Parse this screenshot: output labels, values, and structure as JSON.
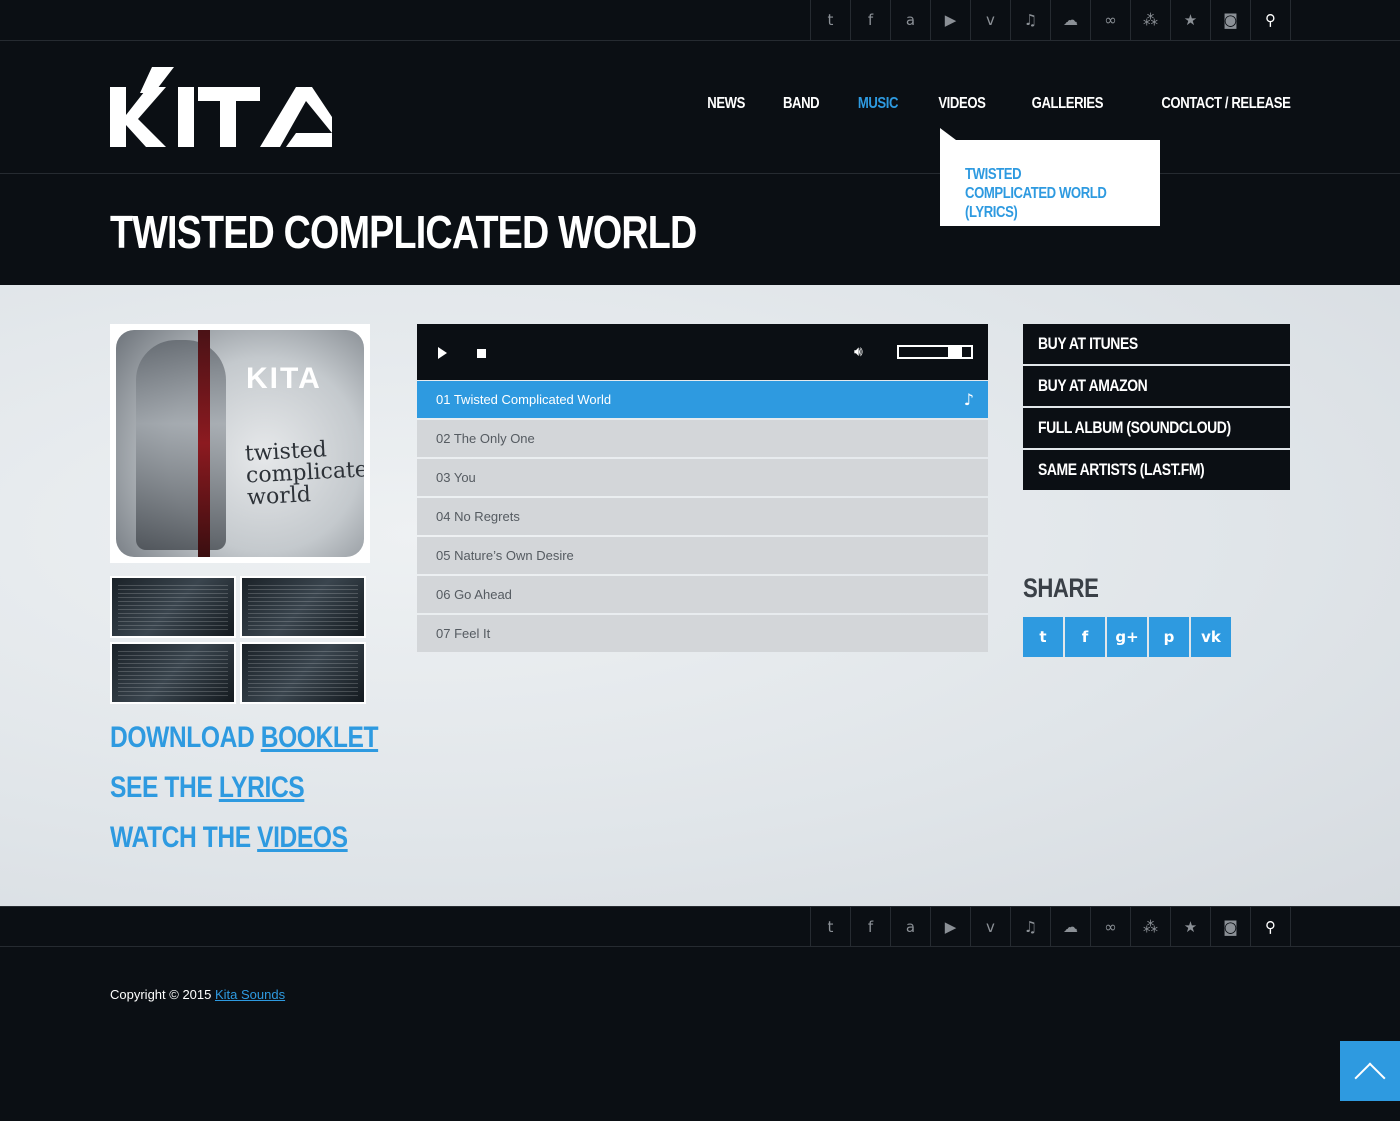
{
  "social_icons": [
    {
      "name": "twitter-icon",
      "glyph": "t"
    },
    {
      "name": "facebook-icon",
      "glyph": "f"
    },
    {
      "name": "amazon-icon",
      "glyph": "a"
    },
    {
      "name": "youtube-icon",
      "glyph": "▶"
    },
    {
      "name": "vimeo-icon",
      "glyph": "v"
    },
    {
      "name": "itunes-icon",
      "glyph": "♫"
    },
    {
      "name": "soundcloud-icon",
      "glyph": "☁"
    },
    {
      "name": "lastfm-icon",
      "glyph": "∞"
    },
    {
      "name": "myspace-icon",
      "glyph": "⁂"
    },
    {
      "name": "reverbnation-icon",
      "glyph": "★"
    },
    {
      "name": "instagram-icon",
      "glyph": "◙"
    },
    {
      "name": "search-icon",
      "glyph": "⚲"
    }
  ],
  "logo": {
    "text": "KITA"
  },
  "nav": {
    "items": [
      "NEWS",
      "BAND",
      "MUSIC",
      "VIDEOS",
      "GALLERIES",
      "CONTACT / RELEASE"
    ],
    "active": "MUSIC",
    "dropdown_item": "TWISTED COMPLICATED WORLD (LYRICS)"
  },
  "page_title": "TWISTED COMPLICATED WORLD",
  "cover": {
    "band": "KITA",
    "album_text": "twisted complicated world"
  },
  "links": {
    "download": {
      "prefix": "DOWNLOAD ",
      "link": "BOOKLET"
    },
    "lyrics": {
      "prefix": "SEE THE ",
      "link": "LYRICS"
    },
    "videos": {
      "prefix": "WATCH THE ",
      "link": "VIDEOS"
    }
  },
  "player": {
    "play_icon": "play-icon",
    "stop_icon": "stop-icon",
    "volume_icon": "volume-icon",
    "volume_level": 0.85
  },
  "tracks": [
    "01 Twisted Complicated World",
    "02 The Only One",
    "03 You",
    "04 No Regrets",
    "05 Nature’s Own Desire",
    "06 Go Ahead",
    "07 Feel It"
  ],
  "active_track_index": 0,
  "buy": [
    "BUY AT ITUNES",
    "BUY AT AMAZON",
    "FULL ALBUM (SOUNDCLOUD)",
    "SAME ARTISTS (LAST.FM)"
  ],
  "share": {
    "title": "SHARE",
    "icons": [
      {
        "name": "share-twitter-icon",
        "glyph": "t"
      },
      {
        "name": "share-facebook-icon",
        "glyph": "f"
      },
      {
        "name": "share-googleplus-icon",
        "glyph": "g+"
      },
      {
        "name": "share-pinterest-icon",
        "glyph": "p"
      },
      {
        "name": "share-vk-icon",
        "glyph": "vk"
      }
    ]
  },
  "footer": {
    "copyright_prefix": "Copyright © 2015 ",
    "copyright_link": "Kita Sounds"
  },
  "colors": {
    "accent": "#2e9ae0",
    "background": "#0b0f14",
    "track_bg": "#d3d6d9"
  }
}
